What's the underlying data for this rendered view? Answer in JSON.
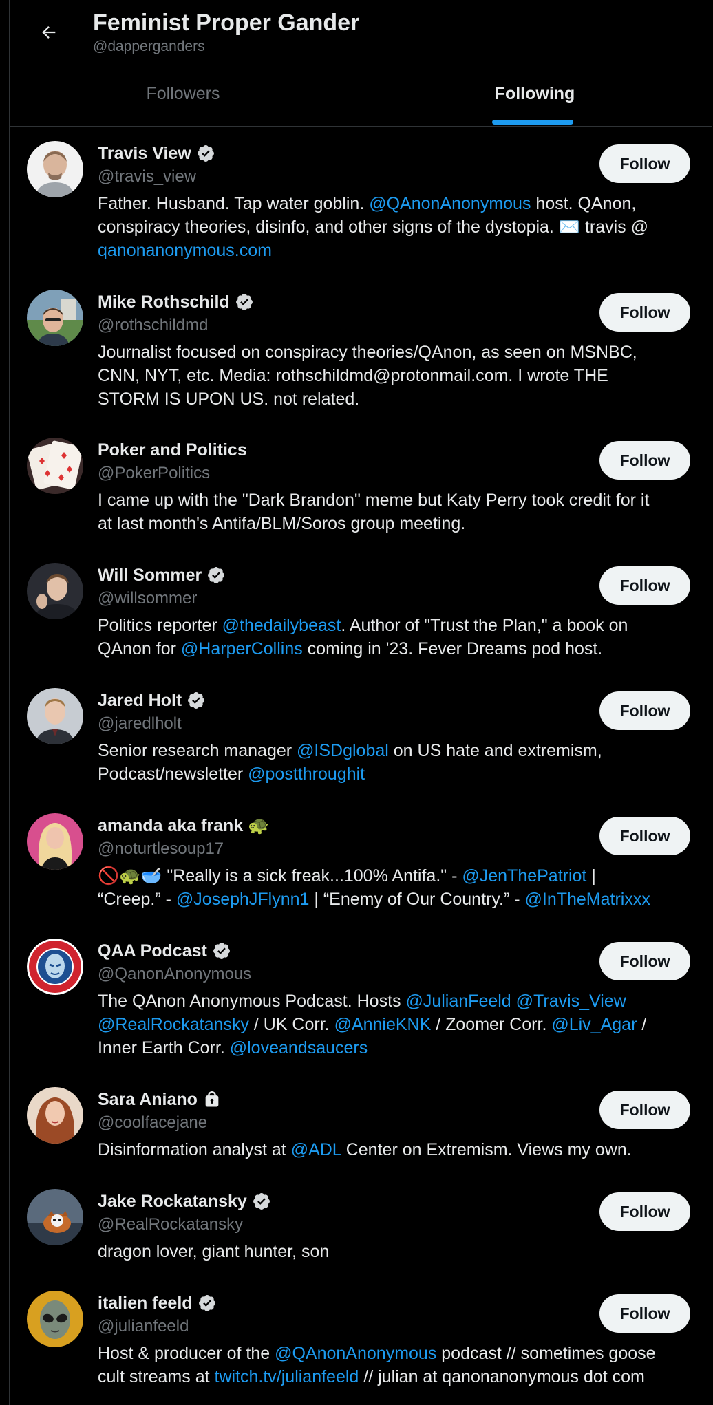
{
  "header": {
    "title": "Feminist Proper Gander",
    "handle": "@dapperganders",
    "tabs": [
      {
        "label": "Followers",
        "active": false
      },
      {
        "label": "Following",
        "active": true
      }
    ]
  },
  "colors": {
    "accent": "#1d9bf0",
    "muted": "#71767b",
    "text": "#e7e9ea",
    "background": "#000000"
  },
  "accounts": [
    {
      "name": "Travis View",
      "verified": true,
      "handle": "@travis_view",
      "bio": [
        [
          {
            "t": "Father. Husband. Tap water goblin. "
          },
          {
            "t": "@QAnonAnonymous",
            "link": true
          },
          {
            "t": " host. QAnon,"
          }
        ],
        [
          {
            "t": "conspiracy theories, disinfo, and other signs of the dystopia. ✉️ travis @"
          }
        ],
        [
          {
            "t": "qanonanonymous.com",
            "link": true
          }
        ]
      ],
      "follow_label": "Follow"
    },
    {
      "name": "Mike Rothschild",
      "verified": true,
      "handle": "@rothschildmd",
      "bio": [
        [
          {
            "t": "Journalist focused on conspiracy theories/QAnon, as seen on MSNBC,"
          }
        ],
        [
          {
            "t": "CNN, NYT, etc. Media: rothschildmd@protonmail.com. I wrote THE"
          }
        ],
        [
          {
            "t": "STORM IS UPON US. not related."
          }
        ]
      ],
      "follow_label": "Follow"
    },
    {
      "name": "Poker and Politics",
      "verified": false,
      "handle": "@PokerPolitics",
      "bio": [
        [
          {
            "t": "I came up with the \"Dark Brandon\" meme but Katy Perry took credit for it"
          }
        ],
        [
          {
            "t": "at last month's Antifa/BLM/Soros group meeting."
          }
        ]
      ],
      "follow_label": "Follow"
    },
    {
      "name": "Will Sommer",
      "verified": true,
      "handle": "@willsommer",
      "bio": [
        [
          {
            "t": "Politics reporter "
          },
          {
            "t": "@thedailybeast",
            "link": true
          },
          {
            "t": ". Author of \"Trust the Plan,\" a book on"
          }
        ],
        [
          {
            "t": "QAnon for "
          },
          {
            "t": "@HarperCollins",
            "link": true
          },
          {
            "t": " coming in '23. Fever Dreams pod host."
          }
        ]
      ],
      "follow_label": "Follow"
    },
    {
      "name": "Jared Holt",
      "verified": true,
      "handle": "@jaredlholt",
      "bio": [
        [
          {
            "t": "Senior research manager "
          },
          {
            "t": "@ISDglobal",
            "link": true
          },
          {
            "t": " on US hate and extremism,"
          }
        ],
        [
          {
            "t": "Podcast/newsletter "
          },
          {
            "t": "@postthroughit",
            "link": true
          }
        ]
      ],
      "follow_label": "Follow"
    },
    {
      "name": "amanda aka frank 🐢",
      "verified": false,
      "handle": "@noturtlesoup17",
      "bio": [
        [
          {
            "t": "🚫🐢🥣 \"Really is a sick freak...100% Antifa.\" - "
          },
          {
            "t": "@JenThePatriot",
            "link": true
          },
          {
            "t": " |"
          }
        ],
        [
          {
            "t": "“Creep.” - "
          },
          {
            "t": "@JosephJFlynn1",
            "link": true
          },
          {
            "t": " | “Enemy of Our Country.” - "
          },
          {
            "t": "@InTheMatrixxx",
            "link": true
          }
        ]
      ],
      "follow_label": "Follow"
    },
    {
      "name": "QAA Podcast",
      "verified": true,
      "handle": "@QanonAnonymous",
      "bio": [
        [
          {
            "t": "The QAnon Anonymous Podcast. Hosts "
          },
          {
            "t": "@JulianFeeld",
            "link": true
          },
          {
            "t": " "
          },
          {
            "t": "@Travis_View",
            "link": true
          }
        ],
        [
          {
            "t": "@RealRockatansky",
            "link": true
          },
          {
            "t": " / UK Corr. "
          },
          {
            "t": "@AnnieKNK",
            "link": true
          },
          {
            "t": " / Zoomer Corr. "
          },
          {
            "t": "@Liv_Agar",
            "link": true
          },
          {
            "t": " /"
          }
        ],
        [
          {
            "t": "Inner Earth Corr. "
          },
          {
            "t": "@loveandsaucers",
            "link": true
          }
        ]
      ],
      "follow_label": "Follow"
    },
    {
      "name": "Sara Aniano",
      "verified": false,
      "locked": true,
      "handle": "@coolfacejane",
      "bio": [
        [
          {
            "t": "Disinformation analyst at "
          },
          {
            "t": "@ADL",
            "link": true
          },
          {
            "t": " Center on Extremism. Views my own."
          }
        ]
      ],
      "follow_label": "Follow"
    },
    {
      "name": "Jake Rockatansky",
      "verified": true,
      "handle": "@RealRockatansky",
      "bio": [
        [
          {
            "t": "dragon lover, giant hunter, son"
          }
        ]
      ],
      "follow_label": "Follow"
    },
    {
      "name": "italien feeld",
      "verified": true,
      "handle": "@julianfeeld",
      "bio": [
        [
          {
            "t": "Host & producer of the "
          },
          {
            "t": "@QAnonAnonymous",
            "link": true
          },
          {
            "t": " podcast // sometimes goose"
          }
        ],
        [
          {
            "t": "cult streams at "
          },
          {
            "t": "twitch.tv/julianfeeld",
            "link": true
          },
          {
            "t": " // julian at qanonanonymous dot com"
          }
        ]
      ],
      "follow_label": "Follow"
    }
  ]
}
